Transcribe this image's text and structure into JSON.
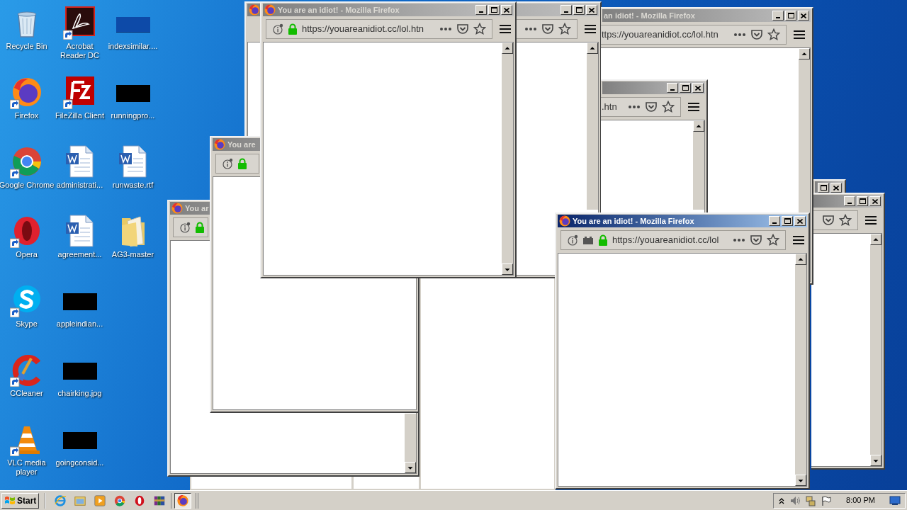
{
  "desktop_icons": [
    {
      "label": "Recycle Bin",
      "kind": "recycle",
      "shortcut": false
    },
    {
      "label": "Firefox",
      "kind": "firefox",
      "shortcut": true
    },
    {
      "label": "Google Chrome",
      "kind": "chrome",
      "shortcut": true
    },
    {
      "label": "Opera",
      "kind": "opera",
      "shortcut": true
    },
    {
      "label": "Skype",
      "kind": "skype",
      "shortcut": true
    },
    {
      "label": "CCleaner",
      "kind": "ccleaner",
      "shortcut": true
    },
    {
      "label": "VLC media player",
      "kind": "vlc",
      "shortcut": true
    },
    {
      "label": "Acrobat Reader DC",
      "kind": "acrobat",
      "shortcut": true
    },
    {
      "label": "FileZilla Client",
      "kind": "filezilla",
      "shortcut": true
    },
    {
      "label": "administrati...",
      "kind": "word",
      "shortcut": false
    },
    {
      "label": "agreement...",
      "kind": "word",
      "shortcut": false
    },
    {
      "label": "appleindian...",
      "kind": "redacted",
      "shortcut": false
    },
    {
      "label": "chairking.jpg",
      "kind": "redacted",
      "shortcut": false
    },
    {
      "label": "goingconsid...",
      "kind": "redacted",
      "shortcut": false
    },
    {
      "label": "indexsimilar....",
      "kind": "blank",
      "shortcut": false
    },
    {
      "label": "runningpro...",
      "kind": "redacted",
      "shortcut": false
    },
    {
      "label": "runwaste.rtf",
      "kind": "word",
      "shortcut": false
    },
    {
      "label": "AG3-master",
      "kind": "folder",
      "shortcut": false
    }
  ],
  "windows": [
    {
      "title": "You ar",
      "active": false
    },
    {
      "active": false
    },
    {
      "title": "You are",
      "active": false
    },
    {
      "title": "You are an idiot! - Mozilla Firefox",
      "url": "https://youareanidiot.cc/lol.htn",
      "active": false
    },
    {
      "active": false
    },
    {
      "active": false
    },
    {
      "title": "an idiot! - Mozilla Firefox",
      "url": "ttps://youareanidiot.cc/lol.htn",
      "active": false
    },
    {
      "url": ".htn",
      "active": false
    },
    {
      "title": "You are an idiot! - Mozilla Firefox",
      "url": "https://youareanidiot.cc/lol",
      "active": true
    }
  ],
  "taskbar": {
    "start": "Start",
    "buttons": [
      {
        "kind": "ie",
        "selected": false
      },
      {
        "kind": "explorer",
        "selected": false
      },
      {
        "kind": "media",
        "selected": false
      },
      {
        "kind": "chrome",
        "selected": false
      },
      {
        "kind": "opera",
        "selected": false
      },
      {
        "kind": "winrar",
        "selected": false
      },
      {
        "kind": "firefox",
        "selected": true
      }
    ],
    "clock": "8:00 PM"
  }
}
